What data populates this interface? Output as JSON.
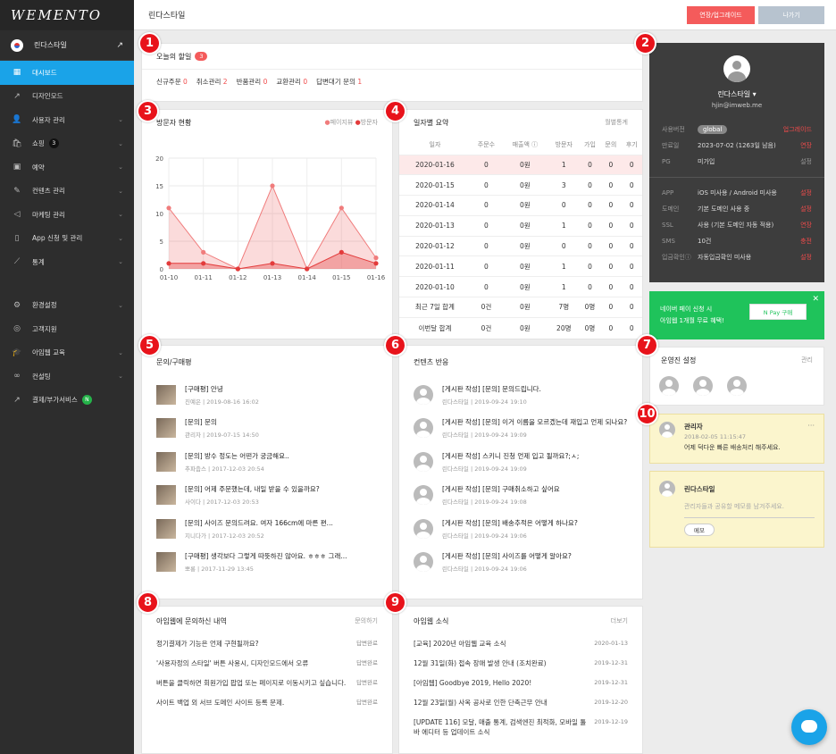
{
  "logo": "WEMENTO",
  "site": {
    "name": "린다스타일"
  },
  "nav": [
    {
      "icon": "▦",
      "label": "대시보드",
      "active": true
    },
    {
      "icon": "↗",
      "label": "디자인모드"
    },
    {
      "icon": "👤",
      "label": "사용자 관리",
      "chev": true
    },
    {
      "icon": "🛍",
      "label": "쇼핑",
      "badge": "3",
      "chev": true
    },
    {
      "icon": "▣",
      "label": "예약",
      "chev": true
    },
    {
      "icon": "✎",
      "label": "컨텐츠 관리",
      "chev": true
    },
    {
      "icon": "◁",
      "label": "마케팅 관리",
      "chev": true
    },
    {
      "icon": "▯",
      "label": "App 신청 및 관리",
      "chev": true
    },
    {
      "icon": "⟋",
      "label": "통계",
      "chev": true
    }
  ],
  "nav2": [
    {
      "icon": "⚙",
      "label": "환경설정",
      "chev": true
    },
    {
      "icon": "◎",
      "label": "고객지원"
    },
    {
      "icon": "🎓",
      "label": "아임웹 교육",
      "chev": true
    },
    {
      "icon": "∞",
      "label": "컨설팅",
      "chev": true
    },
    {
      "icon": "↗",
      "label": "결제/부가서비스",
      "badgeN": "N"
    }
  ],
  "topbar": {
    "title": "린다스타일",
    "upgrade": "연장/업그레이드",
    "exit": "나가기"
  },
  "today": {
    "title": "오늘의 할일",
    "count": "3",
    "items": [
      {
        "label": "신규주문",
        "val": "0"
      },
      {
        "label": "취소관리",
        "val": "2"
      },
      {
        "label": "반품관리",
        "val": "0"
      },
      {
        "label": "교환관리",
        "val": "0"
      },
      {
        "label": "답변대기 문의",
        "val": "1"
      }
    ]
  },
  "visitors": {
    "title": "방문자 현황",
    "legend": [
      "페이지뷰",
      "방문자"
    ]
  },
  "chart_data": {
    "type": "area",
    "categories": [
      "01-10",
      "01-11",
      "01-12",
      "01-13",
      "01-14",
      "01-15",
      "01-16"
    ],
    "series": [
      {
        "name": "페이지뷰",
        "values": [
          11,
          3,
          0,
          15,
          0,
          11,
          2
        ]
      },
      {
        "name": "방문자",
        "values": [
          1,
          1,
          0,
          1,
          0,
          3,
          1
        ]
      }
    ],
    "ylim": [
      0,
      20
    ],
    "yticks": [
      0,
      5,
      10,
      15,
      20
    ],
    "colors": [
      "#f07c7c",
      "#e33b3b"
    ]
  },
  "daily": {
    "title": "일자별 요약",
    "link": "월별통계",
    "headers": [
      "일자",
      "주문수",
      "매출액 ⓘ",
      "방문자",
      "가입",
      "문의",
      "후기"
    ],
    "rows": [
      [
        "2020-01-16",
        "0",
        "0원",
        "1",
        "0",
        "0",
        "0"
      ],
      [
        "2020-01-15",
        "0",
        "0원",
        "3",
        "0",
        "0",
        "0"
      ],
      [
        "2020-01-14",
        "0",
        "0원",
        "0",
        "0",
        "0",
        "0"
      ],
      [
        "2020-01-13",
        "0",
        "0원",
        "1",
        "0",
        "0",
        "0"
      ],
      [
        "2020-01-12",
        "0",
        "0원",
        "0",
        "0",
        "0",
        "0"
      ],
      [
        "2020-01-11",
        "0",
        "0원",
        "1",
        "0",
        "0",
        "0"
      ],
      [
        "2020-01-10",
        "0",
        "0원",
        "1",
        "0",
        "0",
        "0"
      ],
      [
        "최근 7일 합계",
        "0건",
        "0원",
        "7명",
        "0명",
        "0",
        "0"
      ],
      [
        "이번달 합계",
        "0건",
        "0원",
        "20명",
        "0명",
        "0",
        "0"
      ]
    ]
  },
  "inquiry": {
    "title": "문의/구매평",
    "items": [
      {
        "t": "[구매평] 안녕",
        "m": "진예은 | 2019-08-16 16:02"
      },
      {
        "t": "[문의] 문의",
        "m": "관리자 | 2019-07-15 14:50"
      },
      {
        "t": "[문의] 방수 정도는 어떤가 궁금해요..",
        "m": "추파춥스 | 2017-12-03 20:54"
      },
      {
        "t": "[문의] 어제 주문했는데, 내일 받을 수 있을까요?",
        "m": "사이다 | 2017-12-03 20:53"
      },
      {
        "t": "[문의] 사이즈 문의드려요. 여자 166cm에 마른 편...",
        "m": "지니다가 | 2017-12-03 20:52"
      },
      {
        "t": "[구매평] 생각보다 그렇게 따뜻하진 않아요. ㅎㅎㅎ 그래...",
        "m": "뽀롱 | 2017-11-29 13:45"
      }
    ]
  },
  "content": {
    "title": "컨텐츠 반응",
    "items": [
      {
        "t": "[게시판 작성] [문의] 문의드립니다.",
        "m": "린다스타일 | 2019-09-24 19:10"
      },
      {
        "t": "[게시판 작성] [문의] 이거 이름을 모르겠는데 재입고 언제 되나요?",
        "m": "린다스타일 | 2019-09-24 19:09"
      },
      {
        "t": "[게시판 작성] 스키니 진청 언제 입고 될까요?;ㅅ;",
        "m": "린다스타일 | 2019-09-24 19:09"
      },
      {
        "t": "[게시판 작성] [문의] 구매취소하고 싶어요",
        "m": "린다스타일 | 2019-09-24 19:08"
      },
      {
        "t": "[게시판 작성] [문의] 배송추적은 어떻게 하나요?",
        "m": "린다스타일 | 2019-09-24 19:06"
      },
      {
        "t": "[게시판 작성] [문의] 사이즈를 어떻게 알아요?",
        "m": "린다스타일 | 2019-09-24 19:06"
      }
    ]
  },
  "asked": {
    "title": "아임웹에 문의하신 내역",
    "link": "문의하기",
    "items": [
      {
        "t": "정기결제가 기능은 언제 구현될까요?",
        "s": "답변완료"
      },
      {
        "t": "'사용자정의 스타일' 버튼 사용시, 디자인모드에서 오류",
        "s": "답변완료"
      },
      {
        "t": "버튼을 클릭하면 회원가입 팝업 또는 페이지로 이동시키고 싶습니다.",
        "s": "답변완료"
      },
      {
        "t": "사이트 백업 외 서브 도메인 사이트 등록 문제.",
        "s": "답변완료"
      }
    ]
  },
  "news": {
    "title": "아임웹 소식",
    "link": "더보기",
    "items": [
      {
        "t": "[교육] 2020년 아임웹 교육 소식",
        "d": "2020-01-13"
      },
      {
        "t": "12월 31일(화) 접속 장애 발생 안내 (조치완료)",
        "d": "2019-12-31"
      },
      {
        "t": "[아임웹] Goodbye 2019, Hello 2020!",
        "d": "2019-12-31"
      },
      {
        "t": "12월 23일(월) 사옥 공사로 인한 단축근무 안내",
        "d": "2019-12-20"
      },
      {
        "t": "[UPDATE 116] 모달, 매출 통계, 검색엔진 최적화, 모바일 툴바 에디터 등 업데이트 소식",
        "d": "2019-12-19"
      }
    ]
  },
  "profile": {
    "name": "린다스타일 ▾",
    "email": "hjin@imweb.me",
    "rows": [
      {
        "k": "사용버전",
        "v": "global",
        "a": "업그레이드",
        "pill": true
      },
      {
        "k": "만료일",
        "v": "2023-07-02 (1263일 남음)",
        "a": "연장"
      },
      {
        "k": "PG",
        "v": "미가입",
        "a": "설정",
        "g": true
      }
    ],
    "rows2": [
      {
        "k": "APP",
        "v": "iOS 미사용 / Android 미사용",
        "a": "설정"
      },
      {
        "k": "도메인",
        "v": "기본 도메인 사용 중",
        "a": "설정"
      },
      {
        "k": "SSL",
        "v": "사용 (기본 도메인 자동 적용)",
        "a": "연장"
      },
      {
        "k": "SMS",
        "v": "10건",
        "a": "충전"
      },
      {
        "k": "입금확인ⓘ",
        "v": "자동입금확인 미사용",
        "a": "설정"
      }
    ]
  },
  "npay": {
    "line1": "네이버 페이 신청 시",
    "line2": "아임웹 1개월 무료 혜택!",
    "btn": "N Pay 구매"
  },
  "ops": {
    "title": "운영진 설정",
    "link": "관리"
  },
  "memo1": {
    "name": "관리자",
    "date": "2018-02-05 11:15:47",
    "text": "어제 덕다운 빠른 배송처리 해주세요.",
    "more": "···"
  },
  "memo2": {
    "name": "린다스타일",
    "placeholder": "관리자들과 공유할 메모를 남겨주세요.",
    "btn": "메모"
  },
  "markers": [
    "1",
    "2",
    "3",
    "4",
    "5",
    "6",
    "7",
    "8",
    "9",
    "10"
  ]
}
